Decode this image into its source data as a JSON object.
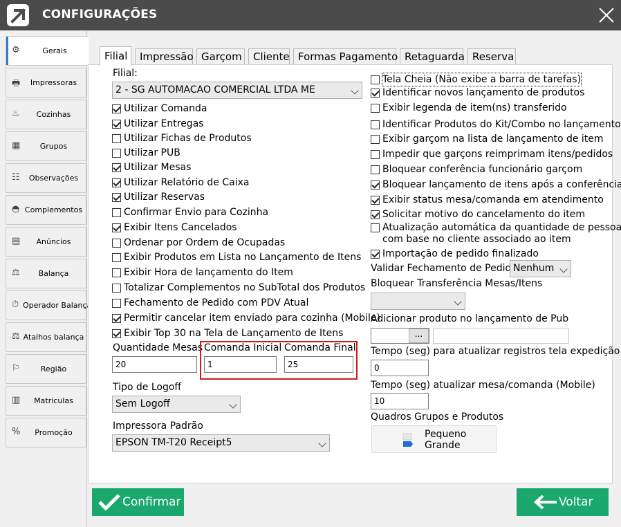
{
  "window": {
    "title": "CONFIGURAÇÕES"
  },
  "sidebar": {
    "items": [
      {
        "label": "Gerais",
        "icon": "settings-icon"
      },
      {
        "label": "Impressoras",
        "icon": "printer-icon"
      },
      {
        "label": "Cozinhas",
        "icon": "kitchen-icon"
      },
      {
        "label": "Grupos",
        "icon": "groups-icon"
      },
      {
        "label": "Observações",
        "icon": "clipboard-icon"
      },
      {
        "label": "Complementos",
        "icon": "bowl-icon"
      },
      {
        "label": "Anúncios",
        "icon": "document-icon"
      },
      {
        "label": "Balança",
        "icon": "scale-icon"
      },
      {
        "label": "Operador Balança",
        "icon": "timer-icon"
      },
      {
        "label": "Atalhos balança",
        "icon": "scale-shortcut-icon"
      },
      {
        "label": "Região",
        "icon": "flag-icon"
      },
      {
        "label": "Matriculas",
        "icon": "registry-icon"
      },
      {
        "label": "Promoção",
        "icon": "percent-icon"
      }
    ]
  },
  "tabs": [
    "Filial",
    "Impressão",
    "Garçom",
    "Cliente",
    "Formas Pagamento",
    "Retaguarda",
    "Reserva"
  ],
  "left": {
    "filial_label": "Filial:",
    "filial_value": "2 - SG AUTOMACAO COMERCIAL LTDA ME",
    "checks": [
      {
        "label": "Utilizar Comanda",
        "checked": true
      },
      {
        "label": "Utilizar Entregas",
        "checked": true
      },
      {
        "label": "Utilizar Fichas de Produtos",
        "checked": false
      },
      {
        "label": "Utilizar PUB",
        "checked": false
      },
      {
        "label": "Utilizar Mesas",
        "checked": true
      },
      {
        "label": "Utilizar Relatório de Caixa",
        "checked": true
      },
      {
        "label": "Utilizar Reservas",
        "checked": true
      },
      {
        "label": "Confirmar Envio para Cozinha",
        "checked": false
      },
      {
        "label": "Exibir Itens Cancelados",
        "checked": true
      },
      {
        "label": "Ordenar por Ordem de Ocupadas",
        "checked": false
      },
      {
        "label": "Exibir Produtos em Lista no Lançamento de Itens",
        "checked": false
      },
      {
        "label": "Exibir Hora de lançamento do Item",
        "checked": false
      },
      {
        "label": "Totalizar Complementos no SubTotal dos Produtos",
        "checked": false
      },
      {
        "label": "Fechamento de Pedido com PDV Atual",
        "checked": false
      },
      {
        "label": "Permitir cancelar item enviado para cozinha (Mobile)",
        "checked": true
      },
      {
        "label": "Exibir Top 30 na Tela de Lançamento de Itens",
        "checked": true
      }
    ],
    "qtd_mesas_label": "Quantidade Mesas",
    "qtd_mesas_value": "20",
    "comanda_inicial_label": "Comanda Inicial",
    "comanda_inicial_value": "1",
    "comanda_final_label": "Comanda Final",
    "comanda_final_value": "25",
    "logoff_label": "Tipo de Logoff",
    "logoff_value": "Sem Logoff",
    "impressora_label": "Impressora Padrão",
    "impressora_value": "EPSON TM-T20 Receipt5"
  },
  "right": {
    "checks": [
      {
        "label": "Tela Cheia (Não exibe a barra de tarefas)",
        "checked": false
      },
      {
        "label": "Identificar novos lançamento de produtos",
        "checked": true
      },
      {
        "label": "Exibir legenda de item(ns) transferido",
        "checked": false
      },
      {
        "label": "Identificar Produtos do Kit/Combo no lançamento",
        "checked": false
      },
      {
        "label": "Exibir garçom na lista de lançamento de item",
        "checked": false
      },
      {
        "label": "Impedir que garçons reimprimam itens/pedidos",
        "checked": false
      },
      {
        "label": "Bloquear conferência funcionário garçom",
        "checked": false
      },
      {
        "label": "Bloquear lançamento de itens após a conferência",
        "checked": true
      },
      {
        "label": "Exibir status mesa/comanda em atendimento",
        "checked": true
      },
      {
        "label": "Solicitar motivo do cancelamento do item",
        "checked": true
      },
      {
        "label": "Atualização automática da quantidade de pessoas",
        "label2": "com base no cliente associado ao item",
        "checked": false
      },
      {
        "label": "Importação de pedido finalizado",
        "checked": true
      }
    ],
    "validar_label": "Validar Fechamento de Pedido",
    "validar_value": "Nenhum",
    "bloquear_label": "Bloquear Transferência Mesas/Itens",
    "bloquear_value": "",
    "adicionar_label": "Adicionar produto no lançamento de Pub",
    "browse_label": "...",
    "tempo_exp_label": "Tempo (seg) para atualizar registros tela expedição",
    "tempo_exp_value": "0",
    "tempo_mesa_label": "Tempo (seg) atualizar mesa/comanda (Mobile)",
    "tempo_mesa_value": "10",
    "quadros_label": "Quadros Grupos e Produtos",
    "quadros_opt1": "Pequeno",
    "quadros_opt2": "Grande"
  },
  "buttons": {
    "confirm": "Confirmar",
    "back": "Voltar"
  },
  "colors": {
    "titlebar": "#4b4b4b",
    "button_green": "#1aa86d",
    "highlight": "#d01a1a"
  }
}
